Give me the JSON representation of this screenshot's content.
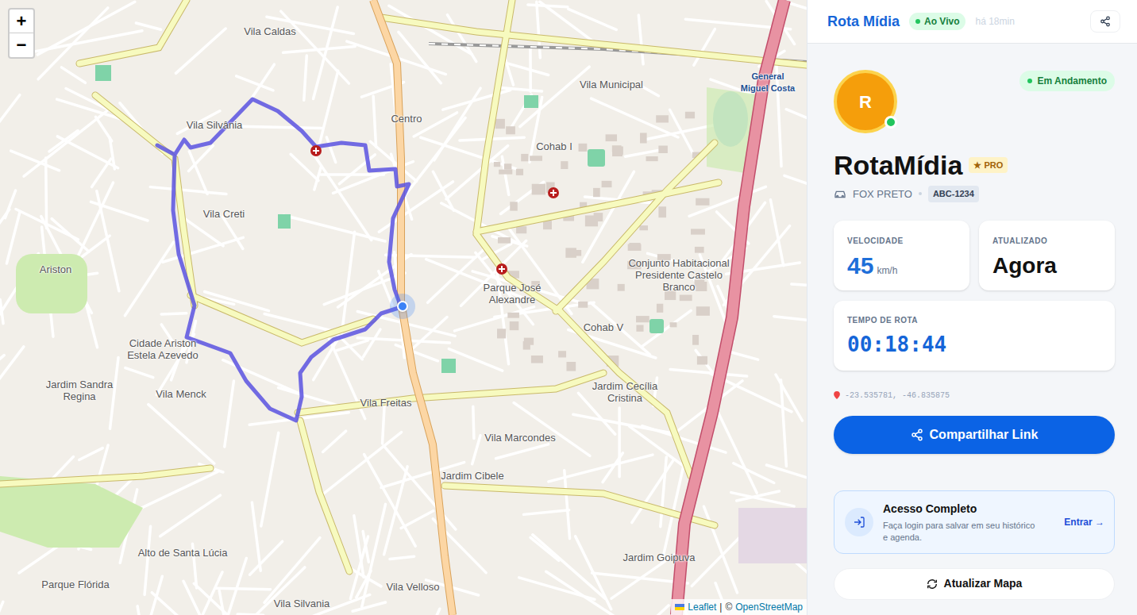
{
  "header": {
    "brand": "Rota Mídia",
    "live": "Ao Vivo",
    "ago": "há 18min"
  },
  "driver": {
    "initial": "R",
    "online": true,
    "status": "Em Andamento",
    "name": "RotaMídia",
    "badge": "★ PRO",
    "vehicle": "FOX PRETO",
    "plate": "ABC-1234"
  },
  "stats": [
    {
      "label": "VELOCIDADE",
      "value": "45",
      "unit": "km/h"
    },
    {
      "label": "ATUALIZADO",
      "value": "Agora"
    }
  ],
  "route_time": {
    "label": "TEMPO DE ROTA",
    "value": "00:18:44"
  },
  "coords": "-23.535781, -46.835875",
  "share_button": "Compartilhar Link",
  "access": {
    "title": "Acesso Completo",
    "text": "Faça login para salvar em seu histórico e agenda.",
    "link": "Entrar →"
  },
  "refresh_button": "Atualizar Mapa",
  "map": {
    "zoom_in": "+",
    "zoom_out": "−",
    "labels": [
      "Vila Caldas",
      "Vila Silvânia",
      "Centro",
      "Vila Municipal",
      "Cohab I",
      "Vila Creti",
      "Ariston",
      "Parque José Alexandre",
      "Conjunto Habitacional Presidente Castelo Branco",
      "Cohab V",
      "Cidade Ariston Estela Azevedo",
      "Jardim Sandra Regina",
      "Vila Menck",
      "Vila Freitas",
      "Jardim Cecília Cristina",
      "Vila Marcondes",
      "Jardim Cibele",
      "Alto de Santa Lúcia",
      "Jardim Goipuva",
      "Vila Velloso",
      "Parque Flórida",
      "Vila Silvania",
      "General Miguel Costa"
    ],
    "attribution": {
      "leaflet": "Leaflet",
      "separator": "|",
      "copyright": "©",
      "osm": "OpenStreetMap"
    }
  }
}
